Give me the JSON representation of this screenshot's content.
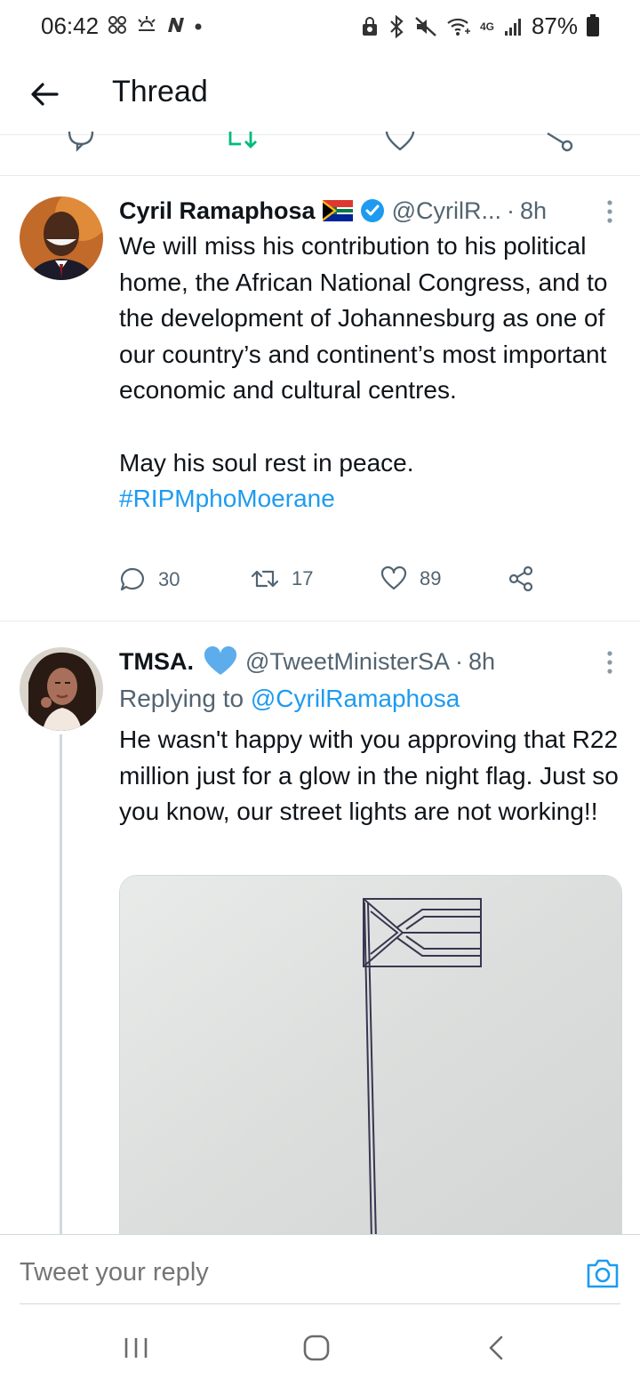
{
  "status_bar": {
    "time": "06:42",
    "battery": "87%",
    "network": "4G",
    "left_icons": [
      "pinwheel-icon",
      "weather-icon",
      "n-app-icon",
      "dot-icon"
    ],
    "right_icons": [
      "vpn-lock-icon",
      "bluetooth-icon",
      "mute-icon",
      "wifi-icon",
      "signal-icon",
      "battery-icon"
    ]
  },
  "header": {
    "title": "Thread",
    "back_icon": "arrow-left-icon"
  },
  "colors": {
    "accent": "#1d9bf0",
    "retweet_green": "#00ba7c",
    "secondary_text": "#536471",
    "divider": "#e6ecf0"
  },
  "tweets": [
    {
      "display_name": "Cyril Ramaphosa",
      "handle": "@CyrilR...",
      "time": "8h",
      "verified": true,
      "body": "We will miss his contribution to his political home, the African National Congress, and to the development of Johannesburg as one of our country’s and continent’s most important economic and cultural centres.\n\nMay his soul rest in peace.",
      "hashtag": "#RIPMphoMoerane",
      "replies": "30",
      "retweets": "17",
      "likes": "89"
    },
    {
      "display_name": "TMSA.",
      "handle": "@TweetMinisterSA",
      "time": "8h",
      "replying_prefix": "Replying to",
      "replying_to": "@CyrilRamaphosa",
      "body": "He wasn't happy with you approving that R22 million just for a glow in the night flag. Just so you know, our street lights are not working!!"
    }
  ],
  "reply_bar": {
    "placeholder": "Tweet your reply"
  },
  "dot": "·"
}
